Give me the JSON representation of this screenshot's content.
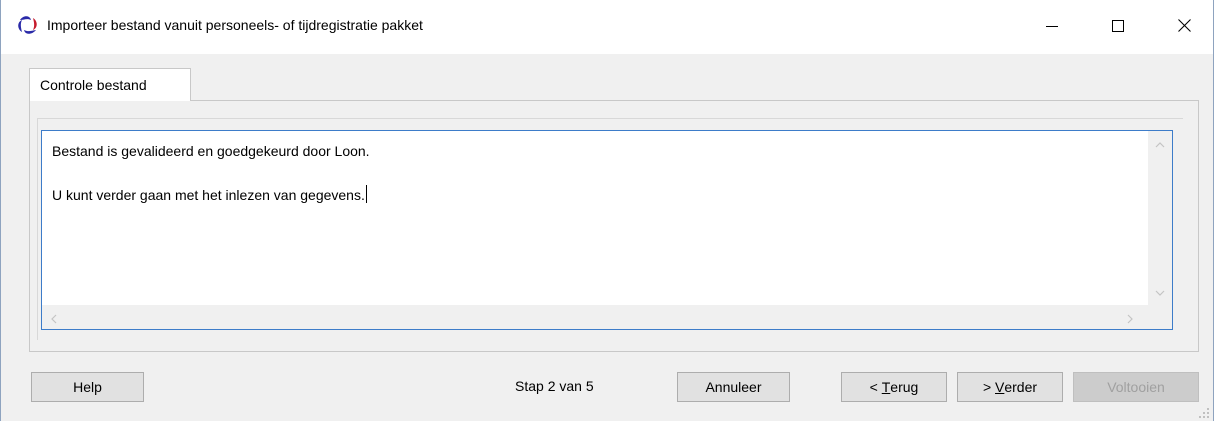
{
  "window": {
    "title": "Importeer bestand vanuit personeels- of tijdregistratie pakket",
    "icon": "app-logo-icon",
    "controls": {
      "minimize": "minimize-icon",
      "maximize": "maximize-icon",
      "close": "close-icon"
    }
  },
  "tabs": [
    {
      "label": "Controle bestand",
      "active": true
    }
  ],
  "message": {
    "line1": "Bestand is gevalideerd en goedgekeurd door Loon.",
    "line2": "U kunt verder gaan met het inlezen van gegevens."
  },
  "footer": {
    "help_label": "Help",
    "step_label": "Stap  2 van  5",
    "cancel_label": "Annuleer",
    "back_prefix": "< ",
    "back_mnemonic": "T",
    "back_rest": "erug",
    "next_prefix": "> ",
    "next_mnemonic": "V",
    "next_rest": "erder",
    "finish_label": "Voltooien",
    "finish_enabled": false
  },
  "colors": {
    "accent_border": "#3d7cc9",
    "window_bg": "#f0f0f0",
    "disabled_text": "#a0a0a0"
  }
}
